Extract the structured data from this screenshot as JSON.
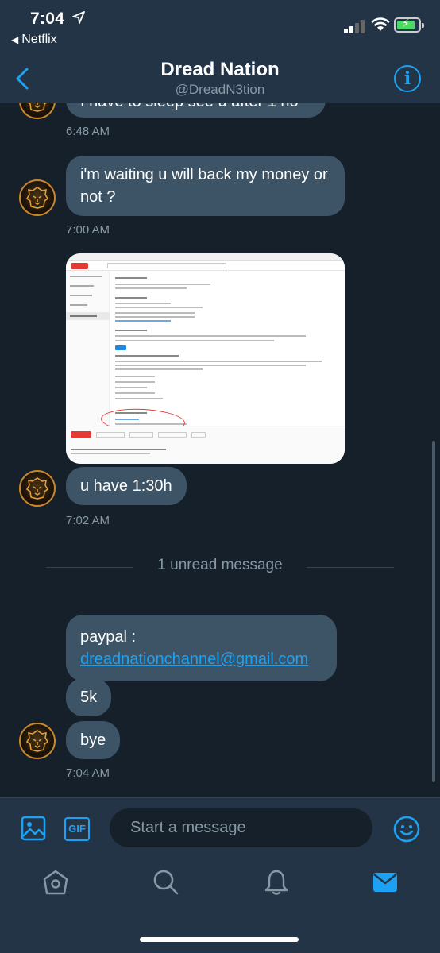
{
  "status_bar": {
    "time": "7:04",
    "back_app": "Netflix"
  },
  "header": {
    "title": "Dread Nation",
    "handle": "@DreadN3tion"
  },
  "messages": {
    "partial_text": "I have to sleep see u after 1 ho",
    "t1": "6:48 AM",
    "m2": "i'm waiting u will back my money or not ?",
    "t2": "7:00 AM",
    "m3": "u have 1:30h",
    "t3": "7:02 AM",
    "divider": "1 unread message",
    "m4_prefix": "paypal :",
    "m4_email": "dreadnationchannel@gmail.com",
    "m5": "5k",
    "m6": "bye",
    "t4": "7:04 AM"
  },
  "composer": {
    "placeholder": "Start a message",
    "gif_label": "GIF"
  },
  "tabs": [
    "home-icon",
    "search-icon",
    "notifications-icon",
    "messages-icon"
  ],
  "colors": {
    "background": "#15202b",
    "bar": "#243447",
    "bubble": "#3d5466",
    "accent": "#1da1f2",
    "muted": "#8899a6"
  }
}
